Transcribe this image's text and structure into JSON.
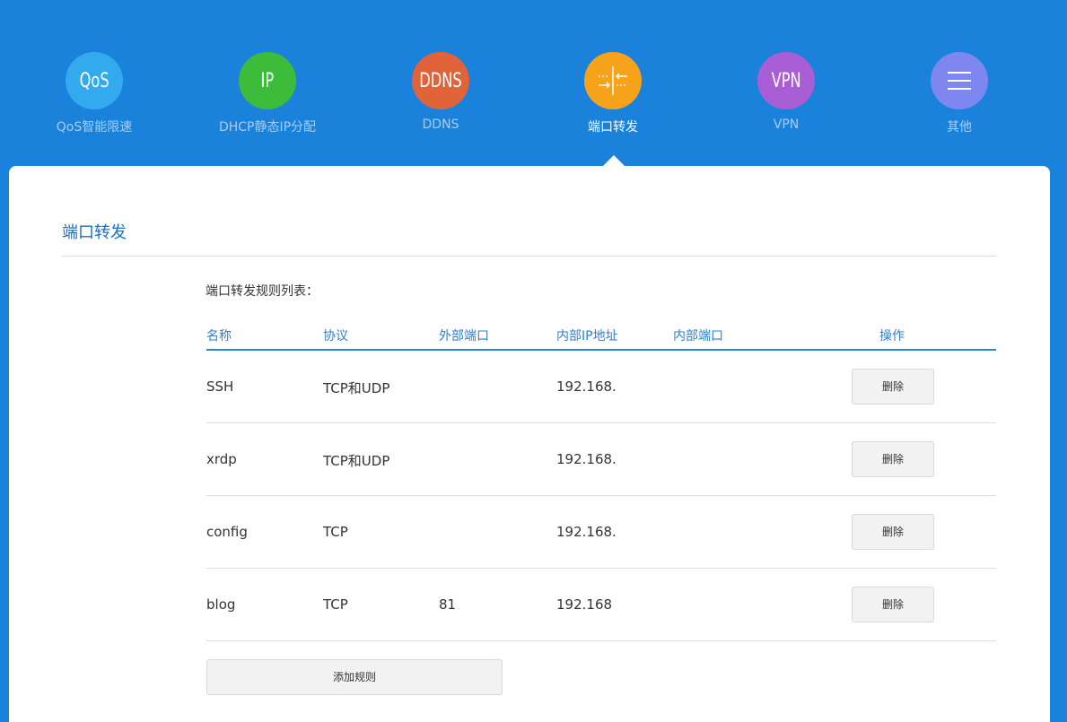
{
  "nav": {
    "items": [
      {
        "icon_text": "QoS",
        "label": "QoS智能限速",
        "color": "#33aaee"
      },
      {
        "icon_text": "IP",
        "label": "DHCP静态IP分配",
        "color": "#3dbb3a"
      },
      {
        "icon_text": "DDNS",
        "label": "DDNS",
        "color": "#e0633a"
      },
      {
        "icon": "port-forward-icon",
        "label": "端口转发",
        "color": "#f7a21b",
        "active": true
      },
      {
        "icon_text": "VPN",
        "label": "VPN",
        "color": "#aa5ed6"
      },
      {
        "icon": "menu-icon",
        "label": "其他",
        "color": "#7e86f0"
      }
    ]
  },
  "panel": {
    "title": "端口转发",
    "list_caption": "端口转发规则列表：",
    "columns": [
      "名称",
      "协议",
      "外部端口",
      "内部IP地址",
      "内部端口",
      "操作"
    ],
    "rows": [
      {
        "name": "SSH",
        "protocol": "TCP和UDP",
        "ext_port": "",
        "ip": "192.168.",
        "int_port": "",
        "action": "删除"
      },
      {
        "name": "xrdp",
        "protocol": "TCP和UDP",
        "ext_port": "",
        "ip": "192.168.",
        "int_port": "",
        "action": "删除"
      },
      {
        "name": "config",
        "protocol": "TCP",
        "ext_port": "",
        "ip": "192.168.",
        "int_port": "",
        "action": "删除"
      },
      {
        "name": "blog",
        "protocol": "TCP",
        "ext_port": "81",
        "ip": "192.168",
        "int_port": "",
        "action": "删除"
      }
    ],
    "add_label": "添加规则"
  },
  "colors": {
    "background": "#1b82dc",
    "accent": "#1c6fbd",
    "header_line": "#2f86d3"
  }
}
